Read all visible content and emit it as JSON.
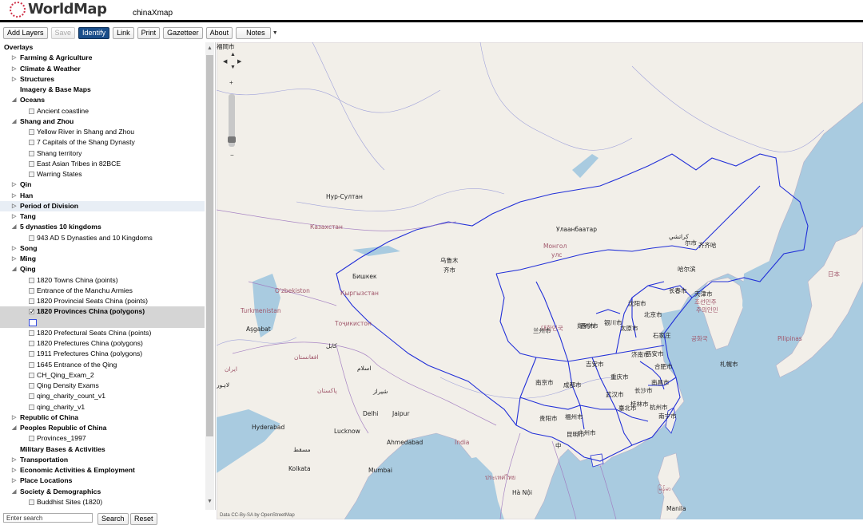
{
  "header": {
    "logo_text": "WorldMap",
    "map_title": "chinaXmap",
    "brand_color": "#d0334a"
  },
  "toolbar": {
    "add_layers": "Add Layers",
    "save": "Save",
    "identify": "Identify",
    "link": "Link",
    "print": "Print",
    "gazetteer": "Gazetteer",
    "about": "About",
    "notes": "Notes"
  },
  "tree": {
    "root": "Overlays",
    "items": [
      {
        "kind": "folder",
        "arrow": "▷",
        "label": "Farming & Agriculture"
      },
      {
        "kind": "folder",
        "arrow": "▷",
        "label": "Climate & Weather"
      },
      {
        "kind": "folder",
        "arrow": "▷",
        "label": "Structures"
      },
      {
        "kind": "folder",
        "arrow": "",
        "label": "Imagery & Base Maps"
      },
      {
        "kind": "folder",
        "arrow": "◢",
        "label": "Oceans"
      },
      {
        "kind": "leaf",
        "label": "Ancient coastline",
        "checked": false
      },
      {
        "kind": "folder",
        "arrow": "◢",
        "label": "Shang and Zhou"
      },
      {
        "kind": "leaf",
        "label": "Yellow River in Shang and Zhou",
        "checked": false
      },
      {
        "kind": "leaf",
        "label": "7 Capitals of the Shang Dynasty",
        "checked": false
      },
      {
        "kind": "leaf",
        "label": "Shang territory",
        "checked": false
      },
      {
        "kind": "leaf",
        "label": "East Asian Tribes in 82BCE",
        "checked": false
      },
      {
        "kind": "leaf",
        "label": "Warring States",
        "checked": false
      },
      {
        "kind": "folder",
        "arrow": "▷",
        "label": "Qin"
      },
      {
        "kind": "folder",
        "arrow": "▷",
        "label": "Han"
      },
      {
        "kind": "folder",
        "arrow": "▷",
        "label": "Period of Division",
        "highlight": true
      },
      {
        "kind": "folder",
        "arrow": "▷",
        "label": "Tang"
      },
      {
        "kind": "folder",
        "arrow": "◢",
        "label": "5 dynasties 10 kingdoms"
      },
      {
        "kind": "leaf",
        "label": "943 AD 5 Dynasties and 10 Kingdoms",
        "checked": false
      },
      {
        "kind": "folder",
        "arrow": "▷",
        "label": "Song"
      },
      {
        "kind": "folder",
        "arrow": "▷",
        "label": "Ming"
      },
      {
        "kind": "folder",
        "arrow": "◢",
        "label": "Qing"
      },
      {
        "kind": "leaf",
        "label": "1820 Towns China (points)",
        "checked": false
      },
      {
        "kind": "leaf",
        "label": "Entrance of the Manchu Armies",
        "checked": false
      },
      {
        "kind": "leaf",
        "label": "1820 Provincial Seats China (points)",
        "checked": false
      },
      {
        "kind": "leaf",
        "label": "1820 Provinces China (polygons)",
        "checked": true,
        "selected": true
      },
      {
        "kind": "legend",
        "label": ""
      },
      {
        "kind": "leaf",
        "label": "1820 Prefectural Seats China (points)",
        "checked": false
      },
      {
        "kind": "leaf",
        "label": "1820 Prefectures China (polygons)",
        "checked": false
      },
      {
        "kind": "leaf",
        "label": "1911 Prefectures China (polygons)",
        "checked": false
      },
      {
        "kind": "leaf",
        "label": "1645 Entrance of the Qing",
        "checked": false
      },
      {
        "kind": "leaf",
        "label": "CH_Qing_Exam_2",
        "checked": false
      },
      {
        "kind": "leaf",
        "label": "Qing Density Exams",
        "checked": false
      },
      {
        "kind": "leaf",
        "label": "qing_charity_count_v1",
        "checked": false
      },
      {
        "kind": "leaf",
        "label": "qing_charity_v1",
        "checked": false
      },
      {
        "kind": "folder",
        "arrow": "▷",
        "label": "Republic of China"
      },
      {
        "kind": "folder",
        "arrow": "◢",
        "label": "Peoples Republic of China"
      },
      {
        "kind": "leaf",
        "label": "Provinces_1997",
        "checked": false
      },
      {
        "kind": "folder",
        "arrow": "",
        "label": "Military Bases & Activities"
      },
      {
        "kind": "folder",
        "arrow": "▷",
        "label": "Transportation"
      },
      {
        "kind": "folder",
        "arrow": "▷",
        "label": "Economic Activities & Employment"
      },
      {
        "kind": "folder",
        "arrow": "▷",
        "label": "Place Locations"
      },
      {
        "kind": "folder",
        "arrow": "◢",
        "label": "Society & Demographics"
      },
      {
        "kind": "leaf",
        "label": "Buddhist Sites (1820)",
        "checked": false
      }
    ]
  },
  "search": {
    "placeholder": "Enter search",
    "search_label": "Search",
    "reset_label": "Reset"
  },
  "map": {
    "labels": [
      {
        "text": "Нур-Султан",
        "cls": ""
      },
      {
        "text": "Казахстан",
        "cls": "country"
      },
      {
        "text": "Улаанбаатар",
        "cls": ""
      },
      {
        "text": "Монгол",
        "cls": "country"
      },
      {
        "text": "улс",
        "cls": "country"
      },
      {
        "text": "乌鲁木",
        "cls": ""
      },
      {
        "text": "齐市",
        "cls": ""
      },
      {
        "text": "Бишкек",
        "cls": ""
      },
      {
        "text": "O'zbekiston",
        "cls": "country"
      },
      {
        "text": "Кыргызстан",
        "cls": "country"
      },
      {
        "text": "Turkmenistan",
        "cls": "country"
      },
      {
        "text": "Aşgabat",
        "cls": ""
      },
      {
        "text": "Тоҷикистон",
        "cls": "country"
      },
      {
        "text": "کابل",
        "cls": ""
      },
      {
        "text": "افغانستان",
        "cls": "country"
      },
      {
        "text": "ایران",
        "cls": "country"
      },
      {
        "text": "اسلام",
        "cls": ""
      },
      {
        "text": "پاکستان",
        "cls": "country"
      },
      {
        "text": "لاہور",
        "cls": ""
      },
      {
        "text": "شیراز",
        "cls": ""
      },
      {
        "text": "Delhi",
        "cls": ""
      },
      {
        "text": "Jaipur",
        "cls": ""
      },
      {
        "text": "Lucknow",
        "cls": ""
      },
      {
        "text": "Ahmedabad",
        "cls": ""
      },
      {
        "text": "India",
        "cls": "country"
      },
      {
        "text": "Kolkata",
        "cls": ""
      },
      {
        "text": "Mumbai",
        "cls": ""
      },
      {
        "text": "Hyderabad",
        "cls": ""
      },
      {
        "text": "مسقط",
        "cls": ""
      },
      {
        "text": "كراتشي",
        "cls": ""
      },
      {
        "text": "齐齐哈",
        "cls": ""
      },
      {
        "text": "尔市",
        "cls": ""
      },
      {
        "text": "哈尔滨",
        "cls": ""
      },
      {
        "text": "长春市",
        "cls": ""
      },
      {
        "text": "沈阳市",
        "cls": ""
      },
      {
        "text": "北京市",
        "cls": ""
      },
      {
        "text": "天津市",
        "cls": ""
      },
      {
        "text": "조선민주",
        "cls": "country"
      },
      {
        "text": "주의인민",
        "cls": "country"
      },
      {
        "text": "공화국",
        "cls": "country"
      },
      {
        "text": "대한민국",
        "cls": "country"
      },
      {
        "text": "兰州市",
        "cls": ""
      },
      {
        "text": "西宁市",
        "cls": ""
      },
      {
        "text": "银川市",
        "cls": ""
      },
      {
        "text": "太原市",
        "cls": ""
      },
      {
        "text": "石家庄",
        "cls": ""
      },
      {
        "text": "济南市",
        "cls": ""
      },
      {
        "text": "郑州市",
        "cls": ""
      },
      {
        "text": "西安市",
        "cls": ""
      },
      {
        "text": "合肥市",
        "cls": ""
      },
      {
        "text": "南京市",
        "cls": ""
      },
      {
        "text": "成都市",
        "cls": ""
      },
      {
        "text": "重庆市",
        "cls": ""
      },
      {
        "text": "武汉市",
        "cls": ""
      },
      {
        "text": "长沙市",
        "cls": ""
      },
      {
        "text": "南昌市",
        "cls": ""
      },
      {
        "text": "杭州市",
        "cls": ""
      },
      {
        "text": "福州市",
        "cls": ""
      },
      {
        "text": "贵阳市",
        "cls": ""
      },
      {
        "text": "昆明市",
        "cls": ""
      },
      {
        "text": "桂林市",
        "cls": ""
      },
      {
        "text": "广州市",
        "cls": ""
      },
      {
        "text": "南宁市",
        "cls": ""
      },
      {
        "text": "臺北市",
        "cls": ""
      },
      {
        "text": "吉安市",
        "cls": ""
      },
      {
        "text": "中",
        "cls": ""
      },
      {
        "text": "Hà Nội",
        "cls": ""
      },
      {
        "text": "ประเทศไทย",
        "cls": "country"
      },
      {
        "text": "မြန်မာ",
        "cls": "country"
      },
      {
        "text": "Manila",
        "cls": ""
      },
      {
        "text": "Pilipinas",
        "cls": "country"
      },
      {
        "text": "日本",
        "cls": "country"
      },
      {
        "text": "札幌市",
        "cls": ""
      },
      {
        "text": "福岡市",
        "cls": ""
      }
    ],
    "attribution": "Data CC-By-SA by OpenStreetMap",
    "land_color": "#f2efe9",
    "water_color": "#a9cbe0",
    "border_color": "#2230d8"
  }
}
